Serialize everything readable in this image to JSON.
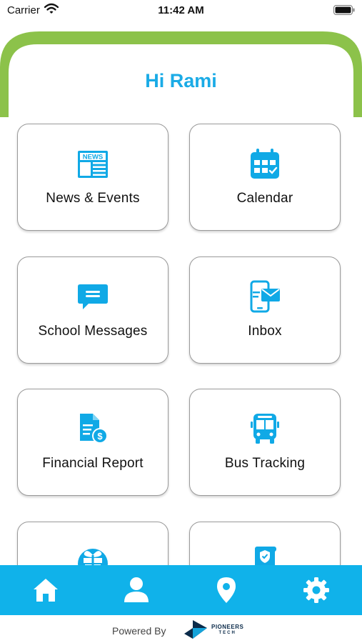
{
  "status_bar": {
    "carrier": "Carrier",
    "time": "11:42 AM"
  },
  "header": {
    "greeting": "Hi Rami"
  },
  "tiles": [
    {
      "label": "News & Events",
      "icon": "news-icon"
    },
    {
      "label": "Calendar",
      "icon": "calendar-icon"
    },
    {
      "label": "School Messages",
      "icon": "chat-bubble-icon"
    },
    {
      "label": "Inbox",
      "icon": "mobile-mail-icon"
    },
    {
      "label": "Financial Report",
      "icon": "financial-document-icon"
    },
    {
      "label": "Bus Tracking",
      "icon": "bus-icon"
    },
    {
      "label": "",
      "icon": "gift-icon"
    },
    {
      "label": "",
      "icon": "certificate-icon"
    }
  ],
  "news_icon_text": "NEWS",
  "bottom_nav": [
    {
      "name": "home",
      "icon": "home-icon"
    },
    {
      "name": "profile",
      "icon": "user-icon"
    },
    {
      "name": "location",
      "icon": "location-pin-icon"
    },
    {
      "name": "settings",
      "icon": "gear-icon"
    }
  ],
  "footer": {
    "powered_by": "Powered By",
    "brand": "PIONEERS",
    "brand_sub": "TECH"
  },
  "colors": {
    "accent": "#10b2ea",
    "greeting": "#1aabe6",
    "header_arc": "#8cc24a",
    "card_border": "#9a9a9a"
  }
}
